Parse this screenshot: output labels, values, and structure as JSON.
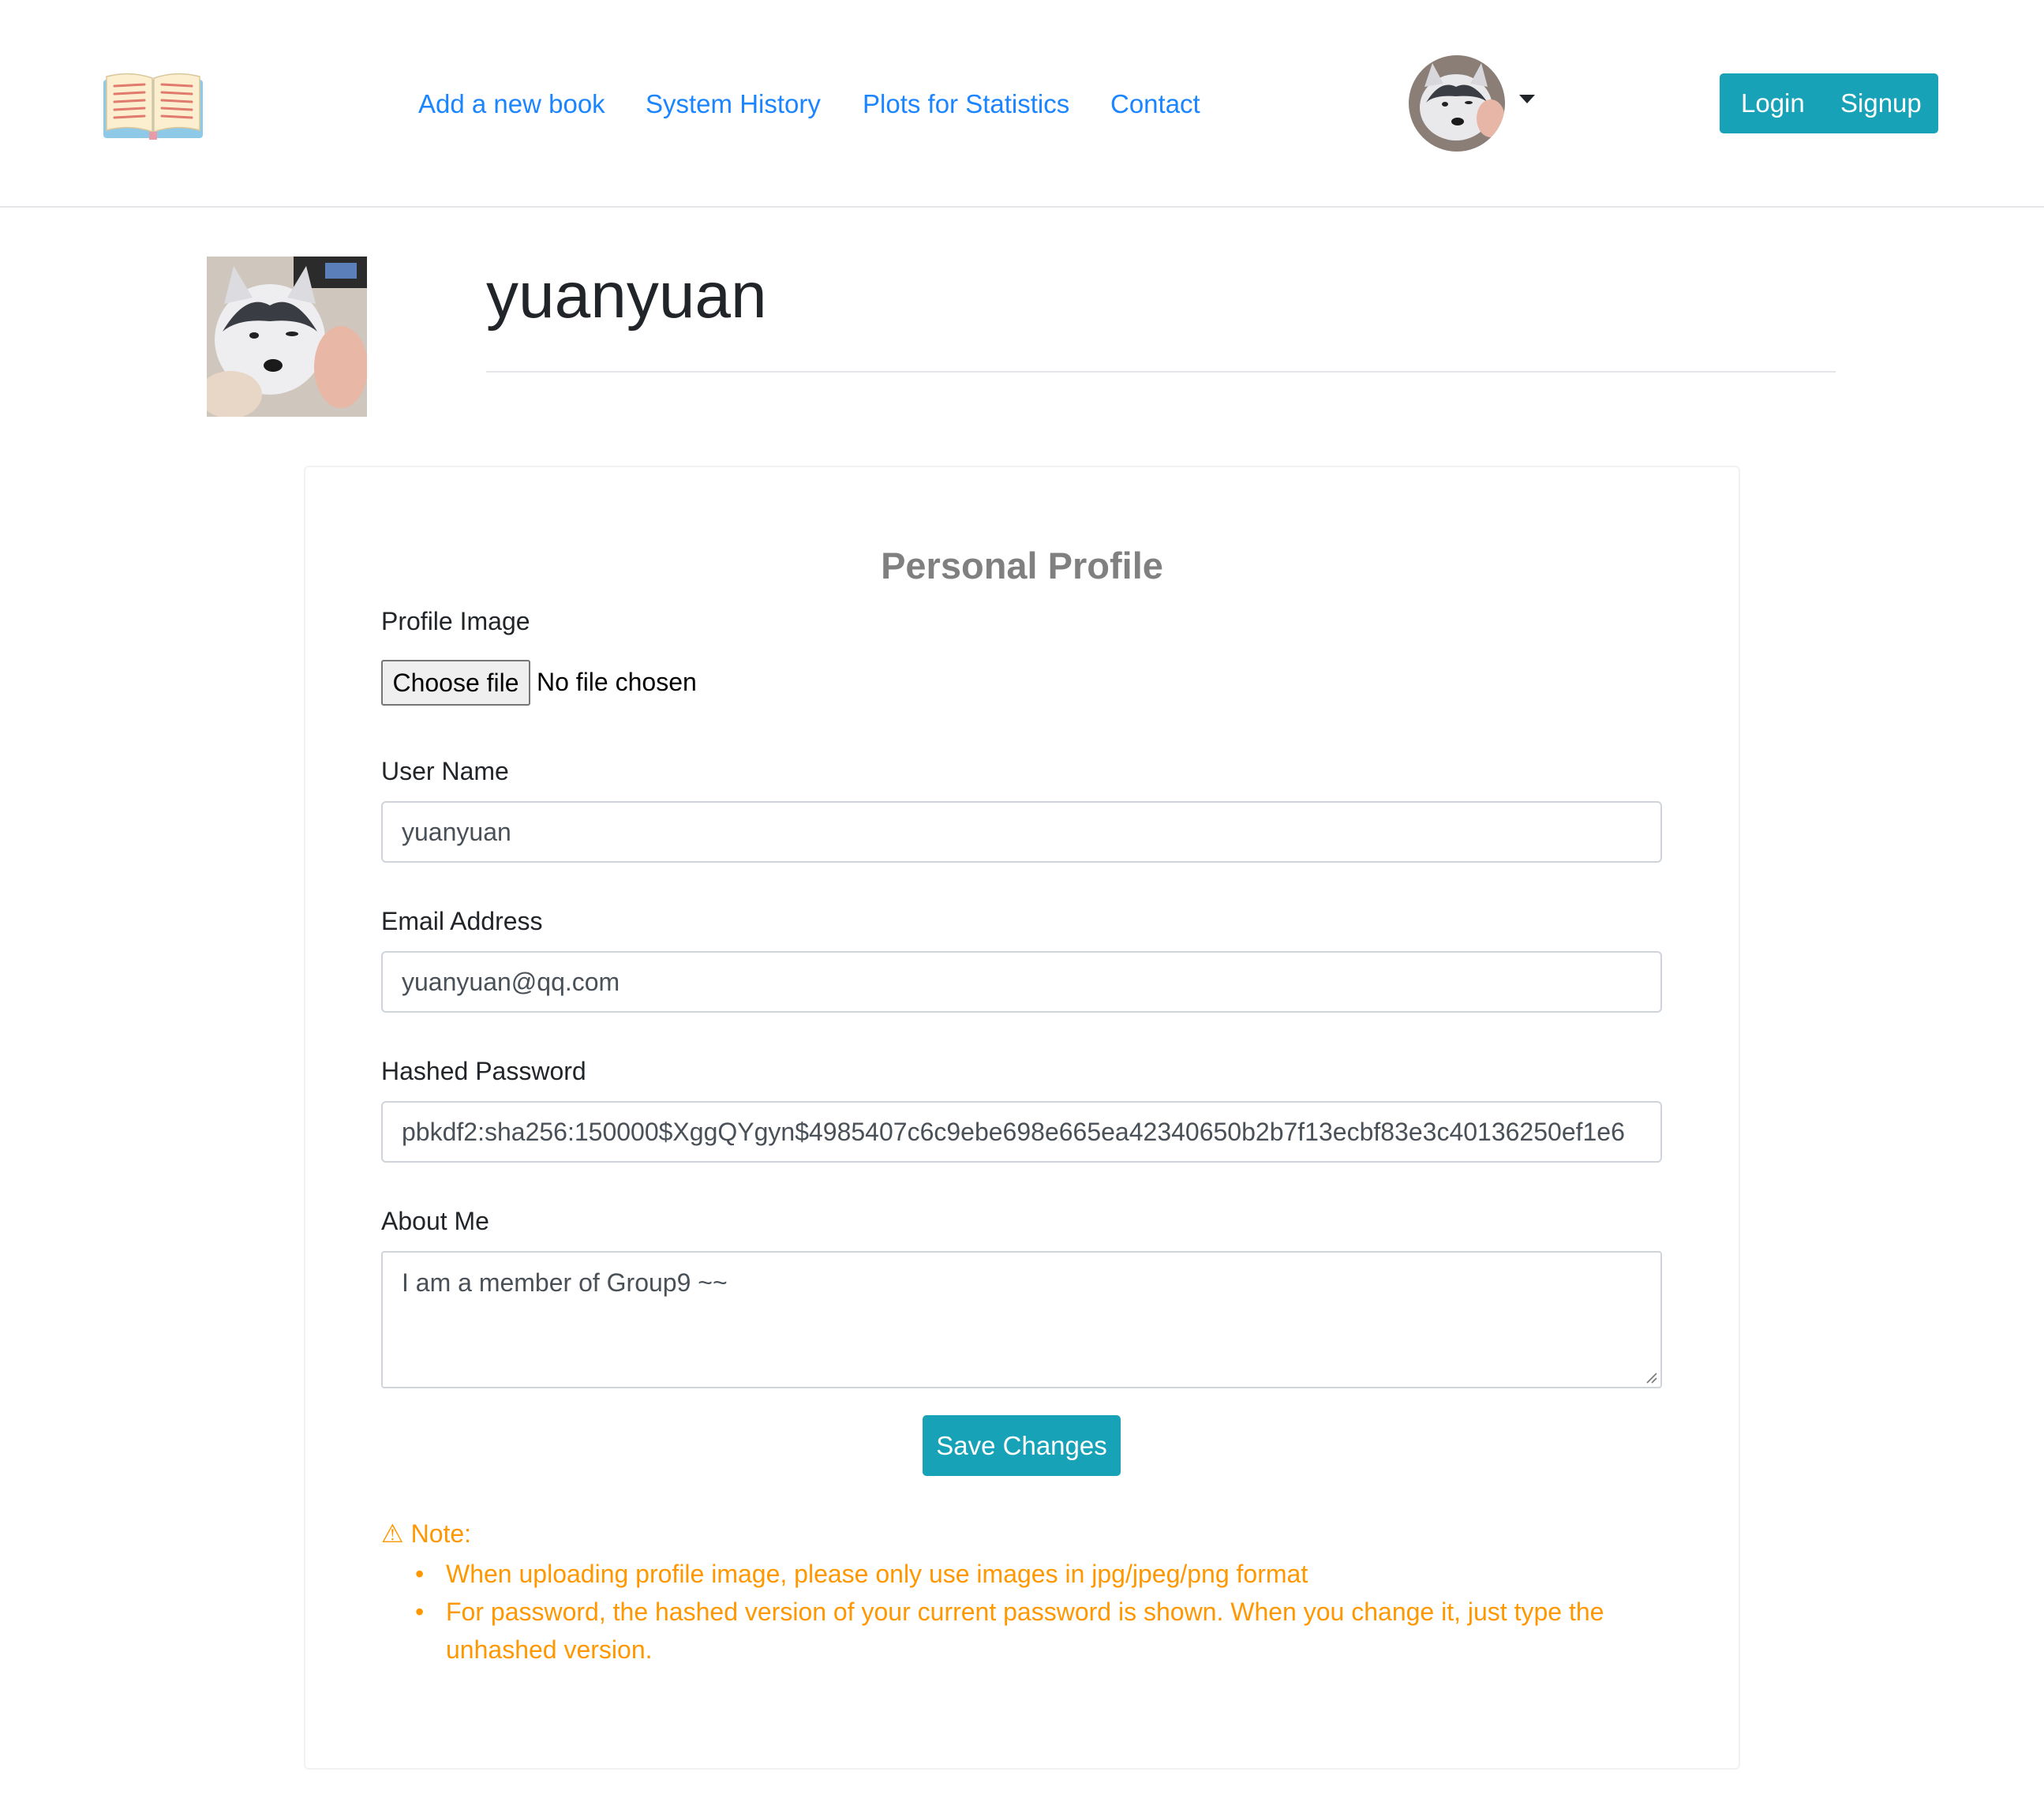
{
  "navbar": {
    "logo_icon": "open-book-icon",
    "links": [
      {
        "label": "Add a new book"
      },
      {
        "label": "System History"
      },
      {
        "label": "Plots for Statistics"
      },
      {
        "label": "Contact"
      }
    ],
    "avatar_icon": "husky-avatar",
    "dropdown_icon": "caret-down-icon",
    "auth": {
      "login_label": "Login",
      "signup_label": "Signup"
    }
  },
  "header": {
    "username": "yuanyuan"
  },
  "profile_form": {
    "title": "Personal Profile",
    "profile_image": {
      "label": "Profile Image",
      "button_label": "Choose file",
      "status": "No file chosen"
    },
    "user_name": {
      "label": "User Name",
      "value": "yuanyuan"
    },
    "email": {
      "label": "Email Address",
      "value": "yuanyuan@qq.com"
    },
    "password": {
      "label": "Hashed Password",
      "value": "pbkdf2:sha256:150000$XggQYgyn$4985407c6c9ebe698e665ea42340650b2b7f13ecbf83e3c40136250ef1e6"
    },
    "about": {
      "label": "About Me",
      "value": "I am a member of Group9 ~~"
    },
    "save_label": "Save Changes"
  },
  "note": {
    "icon": "warning-icon",
    "heading": "⚠ Note:",
    "items": [
      "When uploading profile image, please only use images in jpg/jpeg/png format",
      "For password, the hashed version of your current password is shown. When you change it, just type the unhashed version."
    ]
  },
  "colors": {
    "accent": "#17a2b8",
    "link": "#1a85ff",
    "note": "#ff9800",
    "title_gray": "#808080"
  }
}
